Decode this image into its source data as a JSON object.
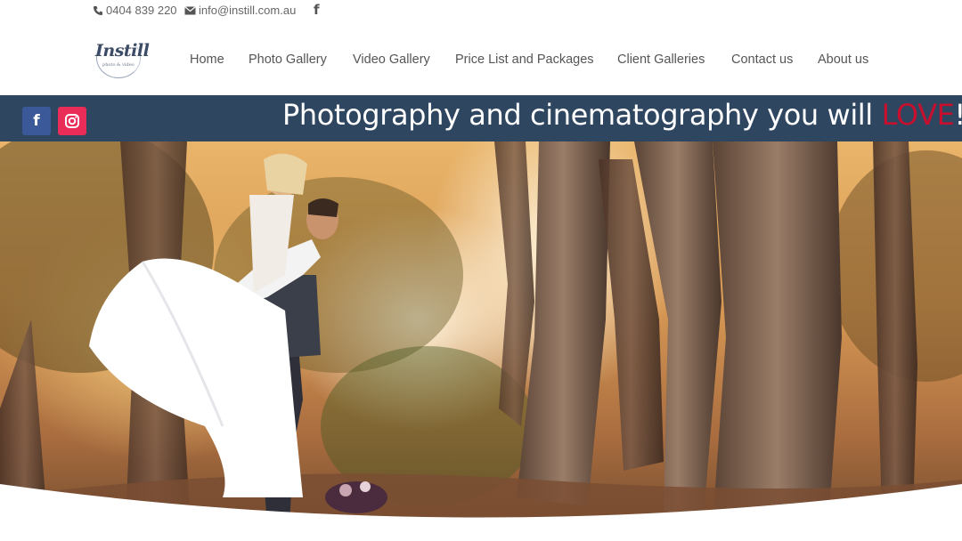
{
  "topbar": {
    "phone": "0404 839 220",
    "email": "info@instill.com.au",
    "facebook_icon": "facebook-icon"
  },
  "logo": {
    "word": "Instill",
    "sub": "photo & video"
  },
  "nav": {
    "items": [
      {
        "label": "Home"
      },
      {
        "label": "Photo Gallery"
      },
      {
        "label": "Video Gallery"
      },
      {
        "label": "Price List and Packages"
      },
      {
        "label": "Client Galleries"
      },
      {
        "label": "Contact us"
      },
      {
        "label": "About us"
      }
    ]
  },
  "banner": {
    "tagline_prefix": "Photography and cinematography you will ",
    "tagline_highlight": "LOVE",
    "tagline_suffix": "!",
    "social": [
      {
        "icon": "facebook-icon",
        "color": "#3b5998"
      },
      {
        "icon": "instagram-icon",
        "color": "#ea2c59"
      }
    ],
    "background": "#2f4660",
    "highlight_color": "#c8102e"
  },
  "hero": {
    "image": "wedding-couple-forest-photo"
  }
}
